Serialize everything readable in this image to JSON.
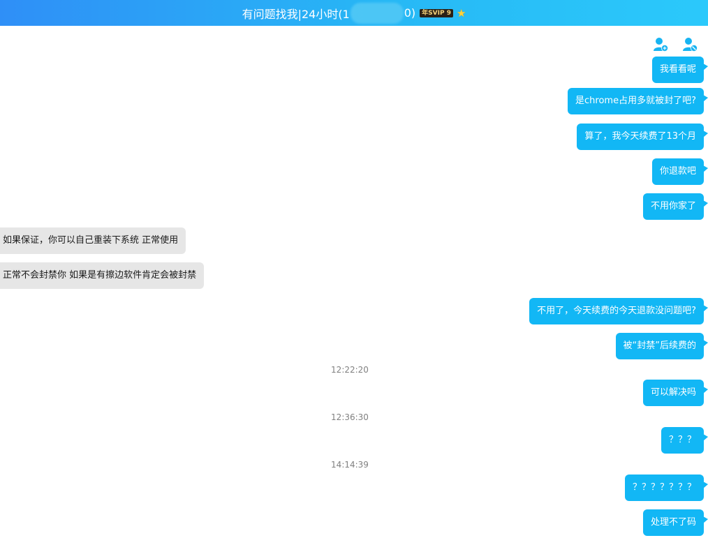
{
  "window": {
    "title_prefix": "有问题找我|24小时(1",
    "title_suffix": "0)",
    "vip_badge": "年SVIP 9",
    "crown_icon": "crown-icon"
  },
  "header_actions": {
    "add_friend_icon": "add-contact-icon",
    "block_icon": "block-contact-icon"
  },
  "colors": {
    "title_gradient_start": "#2f8ff7",
    "title_gradient_end": "#2bc9fb",
    "self_bubble": "#12b7f5",
    "other_bubble": "#e6e6e6",
    "timestamp": "#808080"
  },
  "messages": [
    {
      "side": "self",
      "text": "我看看呢"
    },
    {
      "side": "self",
      "text": "是chrome占用多就被封了吧?"
    },
    {
      "side": "self",
      "text": "算了，我今天续费了13个月"
    },
    {
      "side": "self",
      "text": "你退款吧"
    },
    {
      "side": "self",
      "text": "不用你家了"
    },
    {
      "side": "other",
      "text": "如果保证，你可以自己重装下系统 正常使用"
    },
    {
      "side": "other",
      "text": "正常不会封禁你 如果是有擦边软件肯定会被封禁"
    },
    {
      "side": "self",
      "text": "不用了，今天续费的今天退款没问题吧?"
    },
    {
      "side": "self",
      "text": "被“封禁”后续费的"
    },
    {
      "side": "self",
      "text": "可以解决吗"
    },
    {
      "side": "self",
      "text": "？？？"
    },
    {
      "side": "self",
      "text": "？？？？？？？"
    },
    {
      "side": "self",
      "text": "处理不了码"
    }
  ],
  "timestamps": [
    "12:22:20",
    "12:36:30",
    "14:14:39"
  ]
}
